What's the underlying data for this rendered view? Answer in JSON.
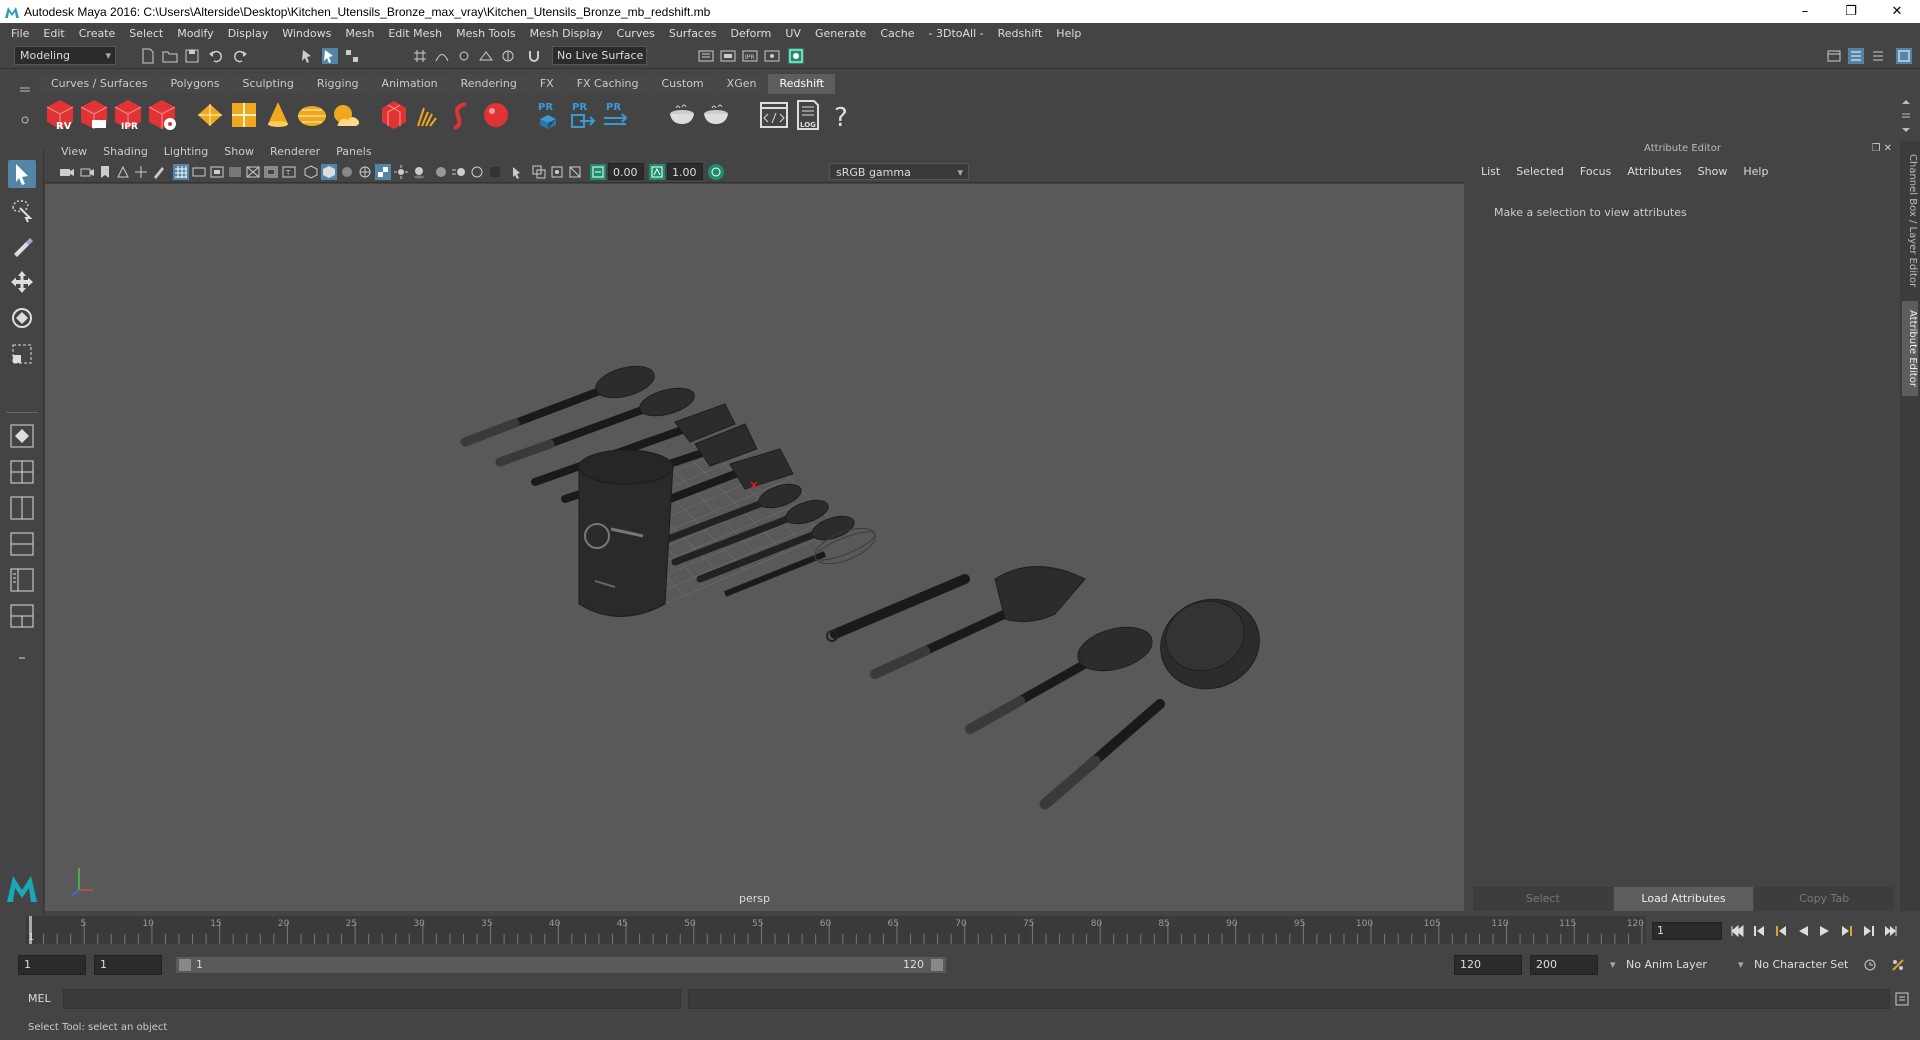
{
  "window": {
    "title": "Autodesk Maya 2016: C:\\Users\\Alterside\\Desktop\\Kitchen_Utensils_Bronze_max_vray\\Kitchen_Utensils_Bronze_mb_redshift.mb",
    "minimize": "–",
    "maximize": "❐",
    "close": "✕"
  },
  "menubar": [
    "File",
    "Edit",
    "Create",
    "Select",
    "Modify",
    "Display",
    "Windows",
    "Mesh",
    "Edit Mesh",
    "Mesh Tools",
    "Mesh Display",
    "Curves",
    "Surfaces",
    "Deform",
    "UV",
    "Generate",
    "Cache",
    "- 3DtoAll -",
    "Redshift",
    "Help"
  ],
  "statusline": {
    "mode": "Modeling",
    "live_surface": "No Live Surface"
  },
  "shelf": {
    "tabs": [
      "Curves / Surfaces",
      "Polygons",
      "Sculpting",
      "Rigging",
      "Animation",
      "Rendering",
      "FX",
      "FX Caching",
      "Custom",
      "XGen",
      "Redshift"
    ],
    "active_tab": "Redshift",
    "rv_label": "RV",
    "ipr_label": "IPR",
    "pr_label": "PR",
    "log_label": "LOG",
    "help_glyph": "?"
  },
  "panel": {
    "menu": [
      "View",
      "Shading",
      "Lighting",
      "Show",
      "Renderer",
      "Panels"
    ],
    "exposure": "0.00",
    "gamma": "1.00",
    "color_space": "sRGB gamma",
    "camera_label": "persp"
  },
  "attribute_editor": {
    "title": "Attribute Editor",
    "menu": [
      "List",
      "Selected",
      "Focus",
      "Attributes",
      "Show",
      "Help"
    ],
    "message": "Make a selection to view attributes",
    "buttons": [
      "Select",
      "Load Attributes",
      "Copy Tab"
    ]
  },
  "side_tabs": [
    "Channel Box / Layer Editor",
    "Attribute Editor"
  ],
  "timeslider": {
    "ticks": [
      "5",
      "10",
      "15",
      "20",
      "25",
      "30",
      "35",
      "40",
      "45",
      "50",
      "55",
      "60",
      "65",
      "70",
      "75",
      "80",
      "85",
      "90",
      "95",
      "100",
      "105",
      "110",
      "115",
      "120"
    ],
    "current_frame_marker": "1",
    "current_frame": "1"
  },
  "range": {
    "start": "1",
    "playback_start": "1",
    "slider_start": "1",
    "slider_end": "120",
    "playback_end": "120",
    "end": "200",
    "anim_layer": "No Anim Layer",
    "character_set": "No Character Set"
  },
  "command_line": {
    "label": "MEL"
  },
  "help_line": "Select Tool: select an object",
  "colors": {
    "background": "#444444",
    "viewport": "#595959",
    "accent": "#5285a6",
    "redshift_red": "#e03434"
  }
}
